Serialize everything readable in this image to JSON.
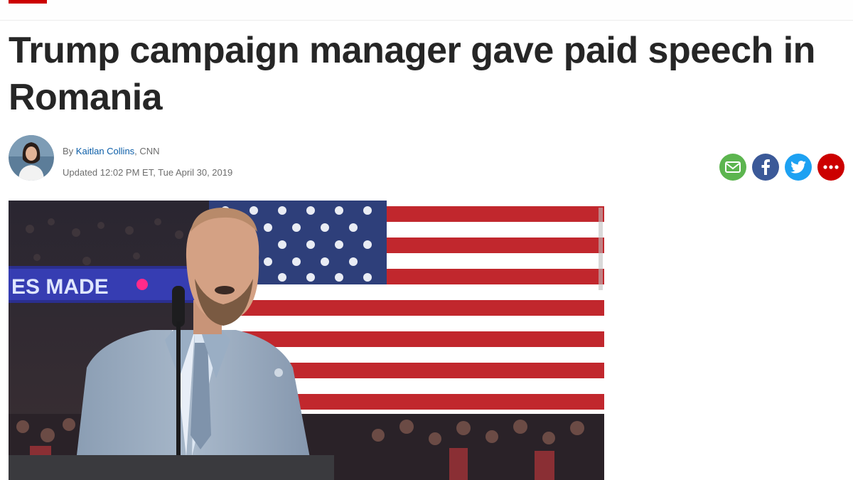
{
  "brand": {
    "accent": "#cc0000"
  },
  "article": {
    "headline": "Trump campaign manager gave paid speech in Romania",
    "byline_prefix": "By ",
    "author": "Kaitlan Collins",
    "outlet": ", CNN",
    "updated": "Updated 12:02 PM ET, Tue April 30, 2019"
  },
  "share": {
    "email": {
      "color": "#5cb54f",
      "icon": "email-icon"
    },
    "facebook": {
      "color": "#3b5998",
      "icon": "facebook-icon"
    },
    "twitter": {
      "color": "#1da1f2",
      "icon": "twitter-icon"
    },
    "more": {
      "color": "#cc0000",
      "icon": "more-icon"
    }
  },
  "photo": {
    "arena_sign": "ES MADE"
  }
}
